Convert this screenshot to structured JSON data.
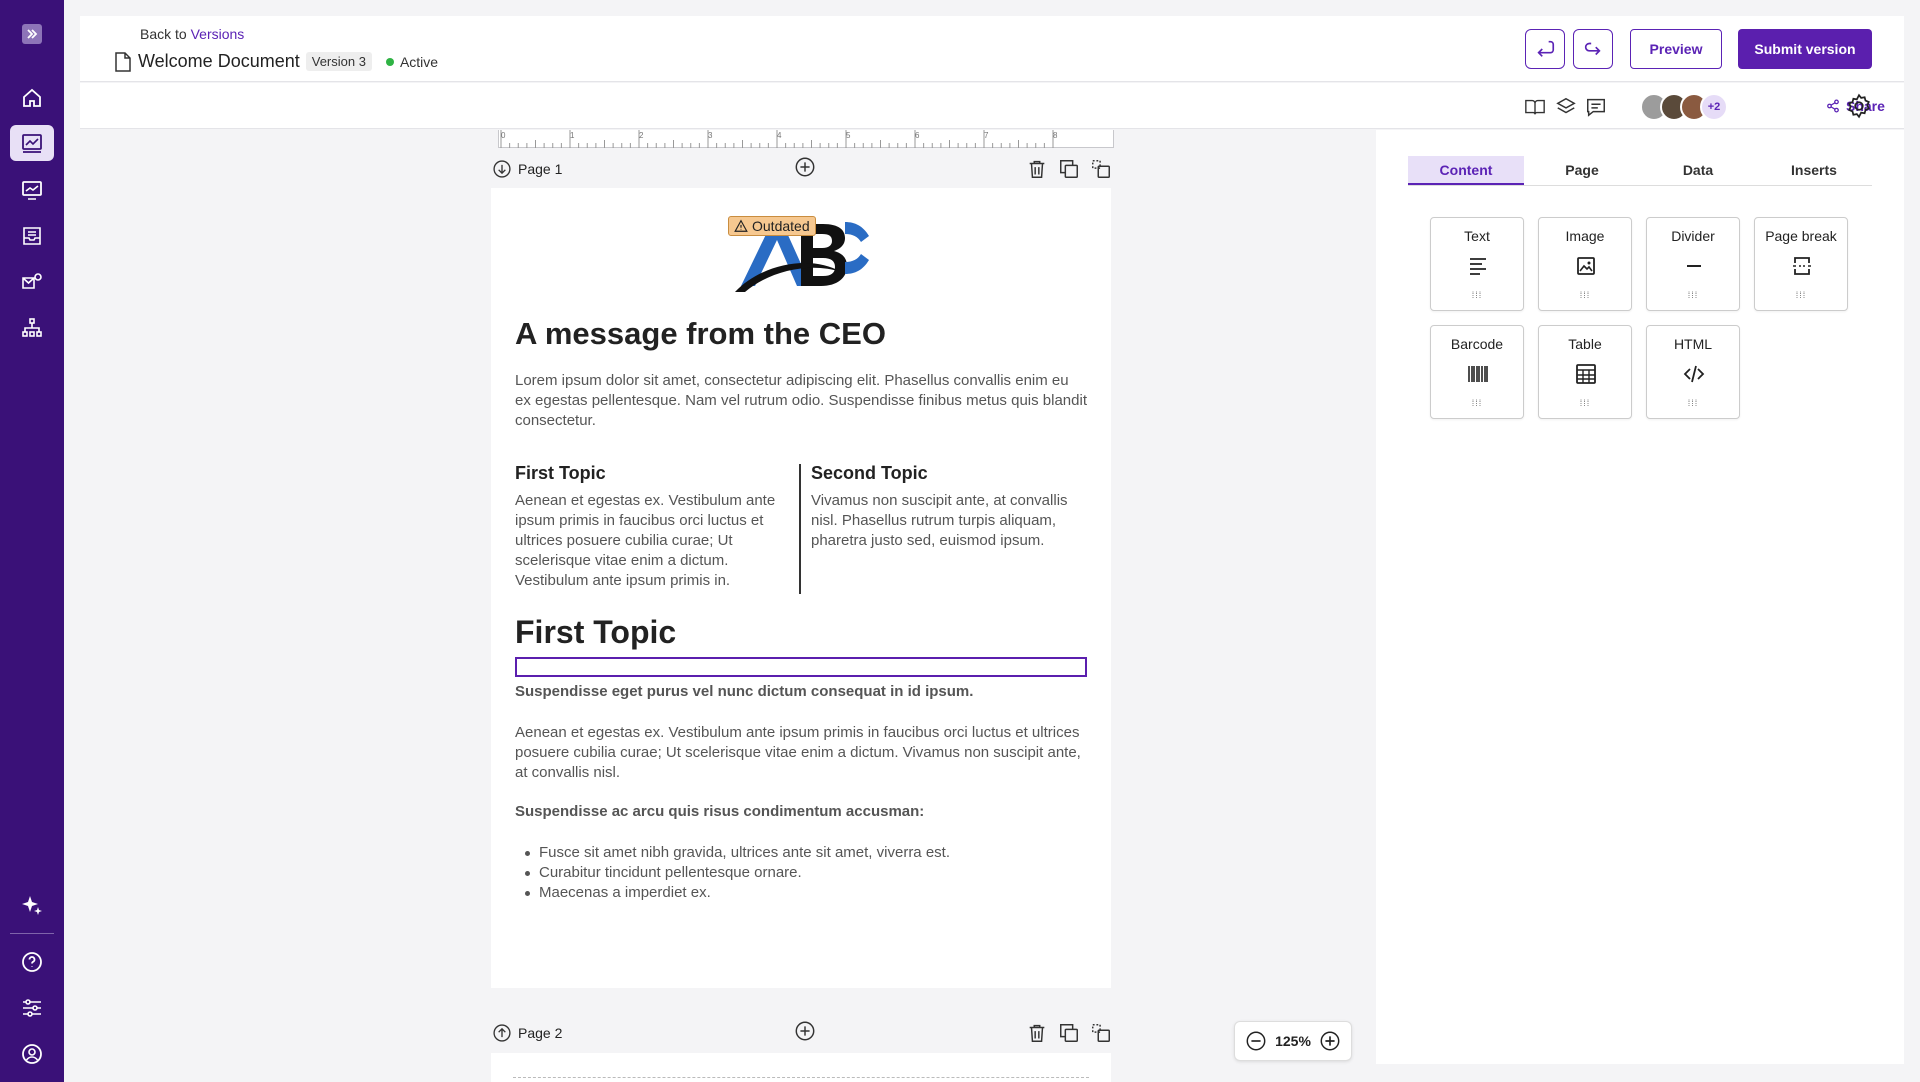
{
  "header": {
    "back_prefix": "Back to",
    "back_link": "Versions",
    "doc_title": "Welcome Document",
    "version": "Version 3",
    "status": "Active",
    "preview_label": "Preview",
    "submit_label": "Submit version"
  },
  "toolbar": {
    "avatars_more": "+2",
    "share_label": "Share"
  },
  "ruler": [
    "0",
    "1",
    "2",
    "3",
    "4",
    "5",
    "6",
    "7",
    "8"
  ],
  "pages": [
    {
      "label": "Page 1"
    },
    {
      "label": "Page 2"
    }
  ],
  "document": {
    "badge": "Outdated",
    "heading": "A message from the CEO",
    "intro": "Lorem ipsum dolor sit amet, consectetur adipiscing elit. Phasellus convallis enim eu ex egestas pellentesque. Nam vel rutrum odio. Suspendisse finibus metus quis blandit consectetur.",
    "col1_title": "First Topic",
    "col1_text": "Aenean et egestas ex. Vestibulum ante ipsum primis in faucibus orci luctus et ultrices posuere cubilia curae; Ut scelerisque vitae enim a dictum. Vestibulum ante ipsum primis in.",
    "col2_title": "Second Topic",
    "col2_text": "Vivamus non suscipit ante, at convallis nisl. Phasellus rutrum turpis aliquam, pharetra justo sed, euismod ipsum.",
    "section_title": "First Topic",
    "bold1": "Suspendisse eget purus vel nunc dictum consequat in id ipsum.",
    "para2": "Aenean et egestas ex. Vestibulum ante ipsum primis in faucibus orci luctus et ultrices posuere cubilia curae; Ut scelerisque vitae enim a dictum. Vivamus non suscipit ante, at convallis nisl.",
    "bold2": "Suspendisse ac arcu quis risus condimentum accusman:",
    "bullets": [
      "Fusce sit amet nibh gravida, ultrices ante sit amet, viverra est.",
      "Curabitur tincidunt pellentesque ornare.",
      "Maecenas a imperdiet ex."
    ]
  },
  "zoom": {
    "level": "125%"
  },
  "panel": {
    "tabs": [
      "Content",
      "Page",
      "Data",
      "Inserts"
    ],
    "tiles": [
      "Text",
      "Image",
      "Divider",
      "Page break",
      "Barcode",
      "Table",
      "HTML"
    ]
  },
  "colors": {
    "sidebar": "#3a1178",
    "accent": "#5b23b5",
    "primary_button": "#5b1fae",
    "status_active": "#2fb344",
    "badge": "#f6c890"
  }
}
